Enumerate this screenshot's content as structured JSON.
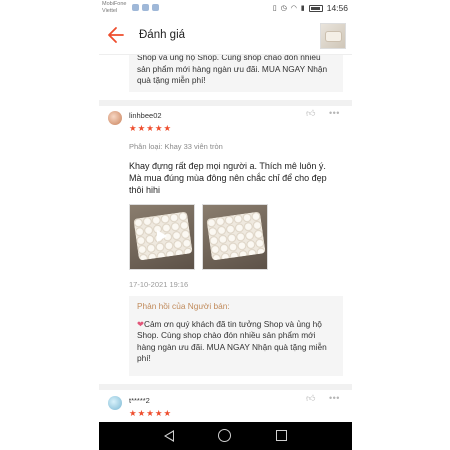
{
  "status_bar": {
    "carrier_line1": "MobiFone",
    "carrier_line2": "Viettel",
    "time": "14:56"
  },
  "header": {
    "title": "Đánh giá",
    "back_icon": "arrow-left-icon"
  },
  "reviews": [
    {
      "seller_reply_partial": "Shop và ủng hộ Shop. Cùng shop chào đón nhiều sản phẩm mới hàng ngàn ưu đãi. MUA NGAY Nhận quà tặng miễn phí!"
    },
    {
      "username": "linhbee02",
      "rating": 5,
      "stars": "★★★★★",
      "variation": "Phân loại: Khay 33 viên tròn",
      "comment": "Khay đựng rất đẹp mọi người a. Thích mê luôn ý. Mà mua đúng mùa đông nên chắc chỉ để cho đẹp thôi hihi",
      "timestamp": "17-10-2021 19:16",
      "seller_reply_title": "Phản hồi của Người bán:",
      "seller_reply": "Cảm ơn quý khách đã tin tưởng Shop và ủng hộ Shop. Cùng shop chào đón nhiều sản phẩm mới hàng ngàn ưu đãi. MUA NGAY Nhận quà tặng miễn phí!"
    },
    {
      "username": "t*****2",
      "rating": 5,
      "stars": "★★★★★"
    }
  ],
  "icons": {
    "like": "thumbs-up-icon",
    "more": "more-dots-icon",
    "play": "play-icon"
  },
  "colors": {
    "star": "#ee4d2d",
    "back_arrow": "#ee4d2d",
    "reply_title": "#c08a5a"
  }
}
